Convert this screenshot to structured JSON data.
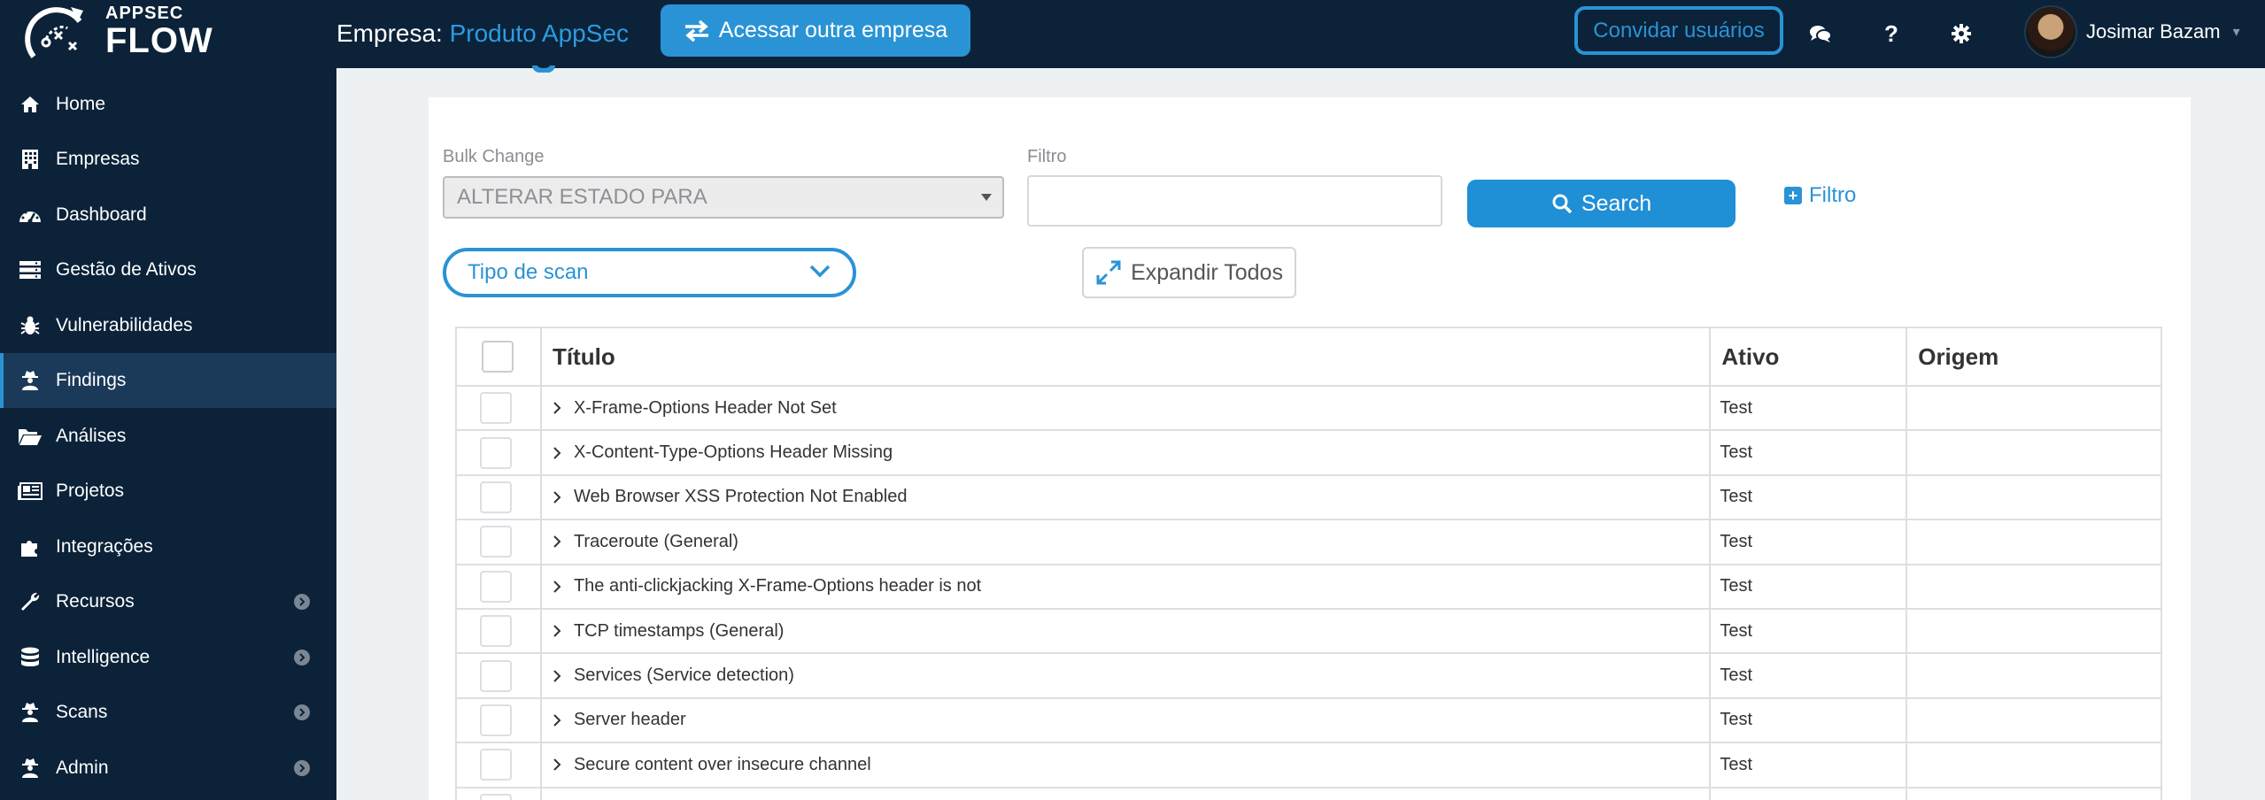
{
  "brand": {
    "line1": "APPSEC",
    "line2": "FLOW"
  },
  "header": {
    "company_prefix": "Empresa:",
    "company_name": "Produto AppSec",
    "switch_company_label": "Acessar outra empresa",
    "invite_label": "Convidar usuários",
    "help_label": "?",
    "user_name": "Josimar Bazam"
  },
  "sidebar": {
    "items": [
      {
        "label": "Home",
        "icon": "home-icon"
      },
      {
        "label": "Empresas",
        "icon": "building-icon"
      },
      {
        "label": "Dashboard",
        "icon": "gauge-icon"
      },
      {
        "label": "Gestão de Ativos",
        "icon": "server-icon"
      },
      {
        "label": "Vulnerabilidades",
        "icon": "bug-icon"
      },
      {
        "label": "Findings",
        "icon": "user-secret-icon",
        "active": true
      },
      {
        "label": "Análises",
        "icon": "folder-open-icon"
      },
      {
        "label": "Projetos",
        "icon": "newspaper-icon"
      },
      {
        "label": "Integrações",
        "icon": "puzzle-icon"
      },
      {
        "label": "Recursos",
        "icon": "wrench-icon",
        "has_submenu": true
      },
      {
        "label": "Intelligence",
        "icon": "database-icon",
        "has_submenu": true
      },
      {
        "label": "Scans",
        "icon": "user-secret-icon",
        "has_submenu": true
      },
      {
        "label": "Admin",
        "icon": "user-secret-icon",
        "has_submenu": true
      }
    ]
  },
  "filters": {
    "bulk_label": "Bulk Change",
    "bulk_value": "ALTERAR ESTADO PARA",
    "filter_label": "Filtro",
    "filter_value": "",
    "search_label": "Search",
    "add_filter_label": "Filtro",
    "scan_type_label": "Tipo de scan",
    "expand_all_label": "Expandir Todos"
  },
  "table": {
    "columns": [
      "Título",
      "Ativo",
      "Origem"
    ],
    "rows": [
      {
        "title": "X-Frame-Options Header Not Set",
        "asset": "Test",
        "origin": ""
      },
      {
        "title": "X-Content-Type-Options Header Missing",
        "asset": "Test",
        "origin": ""
      },
      {
        "title": "Web Browser XSS Protection Not Enabled",
        "asset": "Test",
        "origin": ""
      },
      {
        "title": "Traceroute (General)",
        "asset": "Test",
        "origin": ""
      },
      {
        "title": "The anti-clickjacking X-Frame-Options header is not",
        "asset": "Test",
        "origin": ""
      },
      {
        "title": "TCP timestamps (General)",
        "asset": "Test",
        "origin": ""
      },
      {
        "title": "Services (Service detection)",
        "asset": "Test",
        "origin": ""
      },
      {
        "title": "Server header",
        "asset": "Test",
        "origin": ""
      },
      {
        "title": "Secure content over insecure channel",
        "asset": "Test",
        "origin": ""
      }
    ]
  },
  "colors": {
    "nav_bg": "#0b2239",
    "accent": "#2a93d5",
    "active_nav": "#1b3a59"
  }
}
